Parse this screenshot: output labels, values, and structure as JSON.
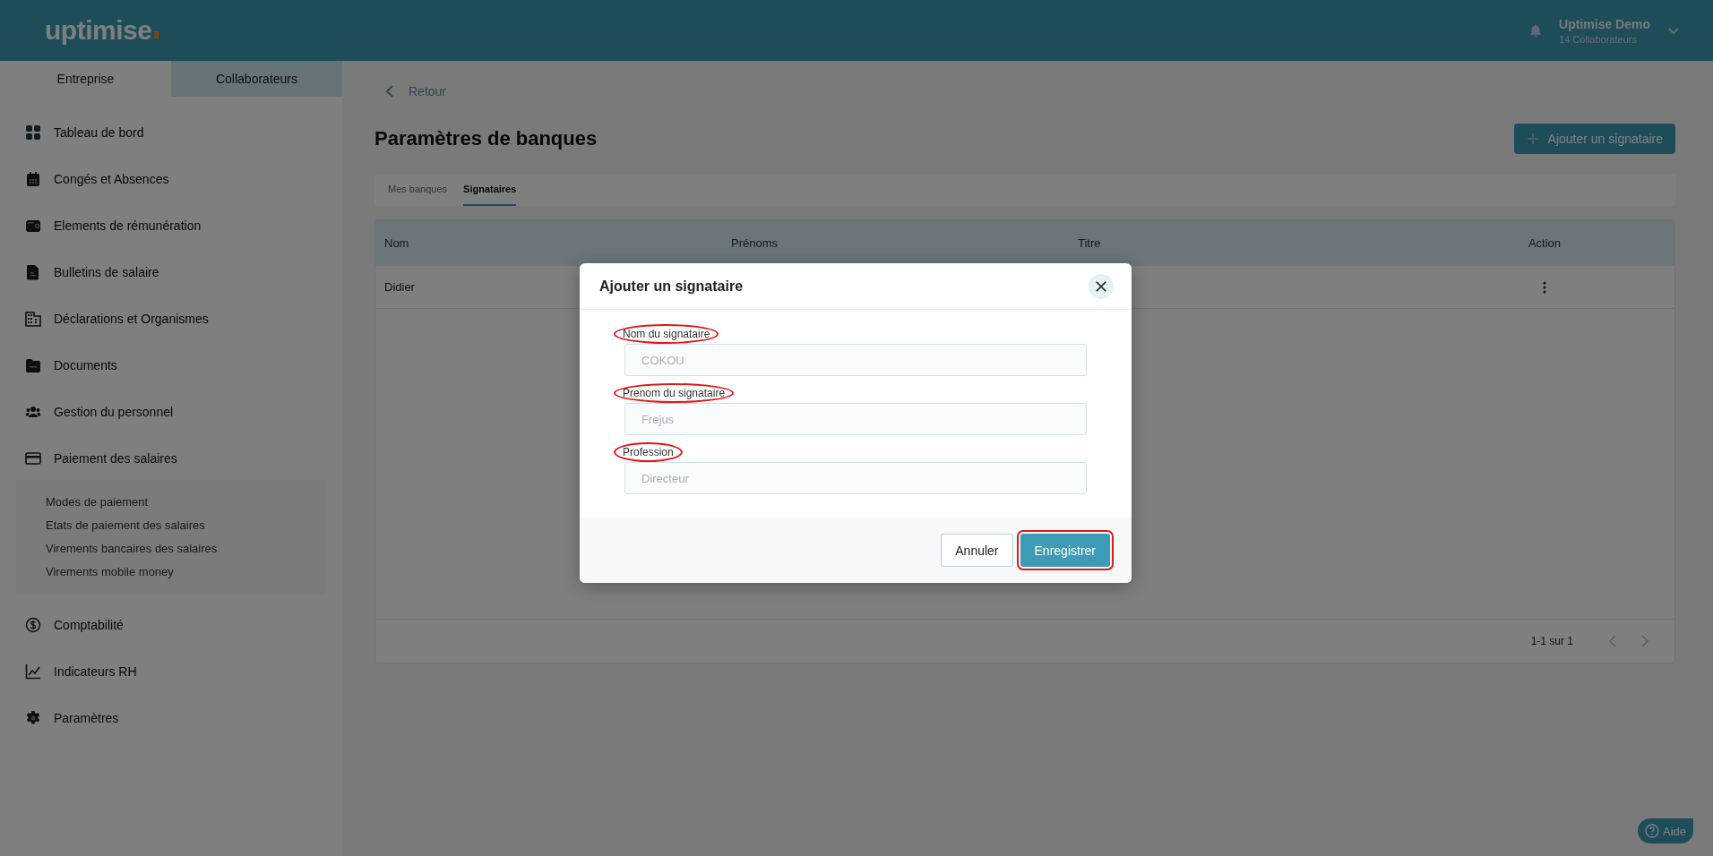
{
  "topbar": {
    "logo": "uptimise",
    "user": {
      "name": "Uptimise Demo",
      "subtitle": "14 Collaborateurs"
    }
  },
  "sidebar": {
    "tabs": [
      {
        "label": "Entreprise",
        "selected": true
      },
      {
        "label": "Collaborateurs",
        "selected": false
      }
    ],
    "items": [
      {
        "label": "Tableau de bord"
      },
      {
        "label": "Congés et Absences"
      },
      {
        "label": "Elements de rémunération"
      },
      {
        "label": "Bulletins de salaire"
      },
      {
        "label": "Déclarations et Organismes"
      },
      {
        "label": "Documents"
      },
      {
        "label": "Gestion du personnel"
      },
      {
        "label": "Paiement des salaires",
        "expanded": true,
        "children": [
          {
            "label": "Modes de paiement"
          },
          {
            "label": "Etats de paiement des salaires"
          },
          {
            "label": "Virements bancaires des salaires"
          },
          {
            "label": "Virements mobile money"
          }
        ]
      },
      {
        "label": "Comptabilité"
      },
      {
        "label": "Indicateurs RH"
      },
      {
        "label": "Paramètres"
      }
    ]
  },
  "main": {
    "back": "Retour",
    "title": "Paramètres de banques",
    "add_button": "Ajouter un signataire",
    "tabs": [
      {
        "label": "Mes banques",
        "selected": false
      },
      {
        "label": "Signataires",
        "selected": true
      }
    ],
    "table": {
      "columns": [
        "Nom",
        "Prénoms",
        "Titre",
        "Action"
      ],
      "rows": [
        {
          "cells": [
            "Didier"
          ]
        }
      ],
      "pagination": "1-1 sur 1"
    }
  },
  "modal": {
    "title": "Ajouter un signataire",
    "fields": [
      {
        "label": "Nom du signataire",
        "placeholder": "COKOU",
        "annotated": true
      },
      {
        "label": "Prenom du signataire",
        "placeholder": "Frejus",
        "annotated": true
      },
      {
        "label": "Profession",
        "placeholder": "Directeur",
        "annotated": true
      }
    ],
    "buttons": [
      {
        "label": "Annuler",
        "kind": "secondary",
        "annotated": false
      },
      {
        "label": "Enregistrer",
        "kind": "primary",
        "annotated": true
      }
    ]
  },
  "help_button": "Aide"
}
